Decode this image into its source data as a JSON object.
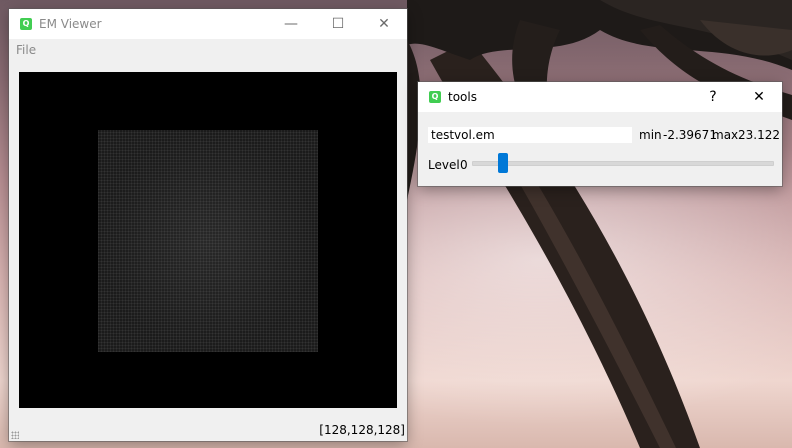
{
  "colors": {
    "accent": "#0078d7",
    "qt_icon": "#41cd52",
    "canvas_bg": "#000000"
  },
  "viewer": {
    "title": "EM Viewer",
    "app_icon": "qt-logo-icon",
    "menu": {
      "file": "File"
    },
    "controls": {
      "minimize": "—",
      "maximize": "☐",
      "close": "✕"
    },
    "status": {
      "dimensions": "[128,128,128]"
    }
  },
  "tools": {
    "title": "tools",
    "app_icon": "qt-logo-icon",
    "controls": {
      "help": "?",
      "close": "✕"
    },
    "filename": "testvol.em",
    "min_label": "min",
    "min_value": "-2.39671",
    "max_label": "max",
    "max_value": "23.122",
    "level_label": "Level",
    "level_value": "0"
  }
}
